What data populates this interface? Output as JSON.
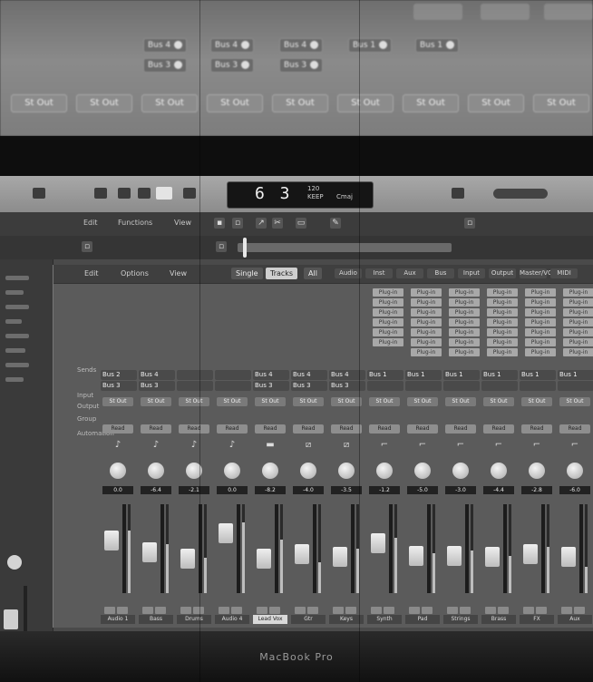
{
  "top_screen": {
    "sends_row1": [
      "Bus 4",
      "Bus 4",
      "Bus 4",
      "Bus 1",
      "Bus 1"
    ],
    "sends_row2": [
      "Bus 3",
      "Bus 3",
      "Bus 3"
    ],
    "outputs": [
      "St Out",
      "St Out",
      "St Out",
      "St Out",
      "St Out",
      "St Out",
      "St Out",
      "St Out",
      "St Out"
    ]
  },
  "control_bar": {
    "lcd_value": "6 3",
    "lcd_labels": [
      "120",
      "KEEP",
      "Cmaj"
    ]
  },
  "toolbar": {
    "edit_label": "Edit",
    "functions_label": "Functions",
    "view_label": "View"
  },
  "mixer": {
    "header": {
      "edit_label": "Edit",
      "options_label": "Options",
      "view_label": "View",
      "segments": [
        {
          "label": "Single",
          "active": false
        },
        {
          "label": "Tracks",
          "active": true
        },
        {
          "label": "All",
          "active": false
        }
      ],
      "filters": [
        "Audio",
        "Inst",
        "Aux",
        "Bus",
        "Input",
        "Output",
        "Master/VCA",
        "MIDI"
      ]
    },
    "row_labels": [
      "Sends",
      "Input",
      "Output",
      "Group",
      "Automation"
    ],
    "channels": [
      {
        "send1": "Bus 2",
        "send2": "Bus 3",
        "io": "St Out",
        "auto": "Read",
        "icon": "♪",
        "readout": "0.0",
        "fader_pct": 62,
        "meter_pct": 70,
        "name": "Audio 1",
        "selected": false
      },
      {
        "send1": "Bus 4",
        "send2": "Bus 3",
        "io": "St Out",
        "auto": "Read",
        "icon": "♪",
        "readout": "-6.4",
        "fader_pct": 45,
        "meter_pct": 55,
        "name": "Bass",
        "selected": false
      },
      {
        "send1": "",
        "send2": "",
        "io": "St Out",
        "auto": "Read",
        "icon": "♪",
        "readout": "-2.1",
        "fader_pct": 35,
        "meter_pct": 40,
        "name": "Drums",
        "selected": false
      },
      {
        "send1": "",
        "send2": "",
        "io": "St Out",
        "auto": "Read",
        "icon": "♪",
        "readout": "0.0",
        "fader_pct": 72,
        "meter_pct": 80,
        "name": "Audio 4",
        "selected": false
      },
      {
        "send1": "Bus 4",
        "send2": "Bus 3",
        "io": "St Out",
        "auto": "Read",
        "icon": "▬",
        "readout": "-8.2",
        "fader_pct": 36,
        "meter_pct": 60,
        "name": "Lead Vox",
        "selected": true
      },
      {
        "send1": "Bus 4",
        "send2": "Bus 3",
        "io": "St Out",
        "auto": "Read",
        "icon": "⧄",
        "readout": "-4.0",
        "fader_pct": 42,
        "meter_pct": 35,
        "name": "Gtr",
        "selected": false
      },
      {
        "send1": "Bus 4",
        "send2": "Bus 3",
        "io": "St Out",
        "auto": "Read",
        "icon": "⧄",
        "readout": "-3.5",
        "fader_pct": 38,
        "meter_pct": 50,
        "name": "Keys",
        "selected": false
      },
      {
        "send1": "Bus 1",
        "send2": "",
        "io": "St Out",
        "auto": "Read",
        "icon": "⌐",
        "readout": "-1.2",
        "fader_pct": 58,
        "meter_pct": 62,
        "name": "Synth",
        "selected": false
      },
      {
        "send1": "Bus 1",
        "send2": "",
        "io": "St Out",
        "auto": "Read",
        "icon": "⌐",
        "readout": "-5.0",
        "fader_pct": 40,
        "meter_pct": 45,
        "name": "Pad",
        "selected": false
      },
      {
        "send1": "Bus 1",
        "send2": "",
        "io": "St Out",
        "auto": "Read",
        "icon": "⌐",
        "readout": "-3.0",
        "fader_pct": 40,
        "meter_pct": 48,
        "name": "Strings",
        "selected": false
      },
      {
        "send1": "Bus 1",
        "send2": "",
        "io": "St Out",
        "auto": "Read",
        "icon": "⌐",
        "readout": "-4.4",
        "fader_pct": 38,
        "meter_pct": 42,
        "name": "Brass",
        "selected": false
      },
      {
        "send1": "Bus 1",
        "send2": "",
        "io": "St Out",
        "auto": "Read",
        "icon": "⌐",
        "readout": "-2.8",
        "fader_pct": 42,
        "meter_pct": 52,
        "name": "FX",
        "selected": false
      },
      {
        "send1": "Bus 1",
        "send2": "",
        "io": "St Out",
        "auto": "Read",
        "icon": "⌐",
        "readout": "-6.0",
        "fader_pct": 38,
        "meter_pct": 30,
        "name": "Aux",
        "selected": false
      }
    ],
    "plugin_label": "Plug-in"
  },
  "bezel": {
    "label": "MacBook Pro"
  }
}
